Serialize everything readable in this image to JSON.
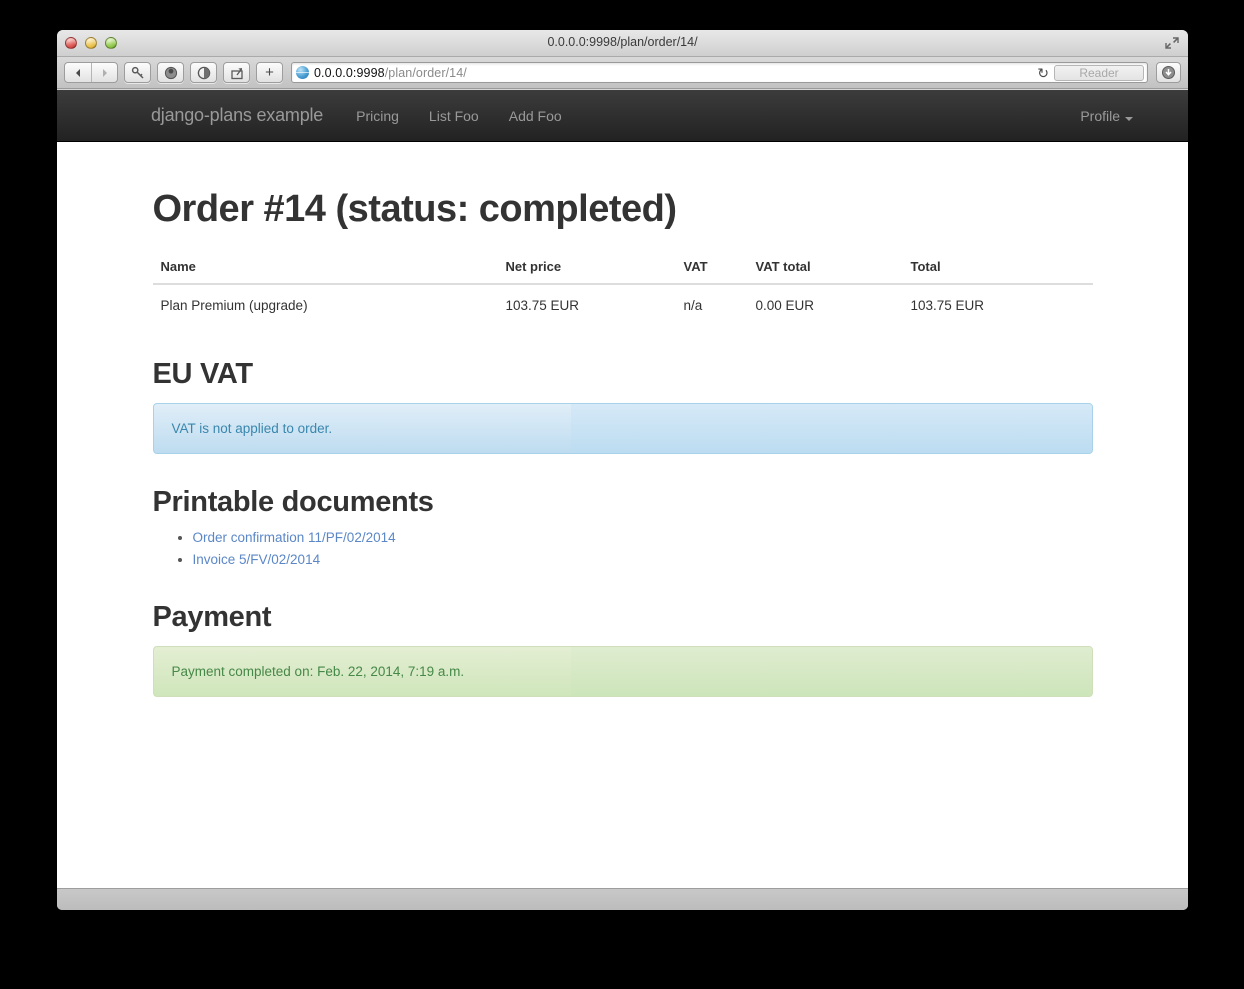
{
  "window": {
    "title": "0.0.0.0:9998/plan/order/14/",
    "fullscreen_icon": "fullscreen-arrows-icon",
    "traffic_lights": [
      "close",
      "minimize",
      "zoom"
    ]
  },
  "toolbar": {
    "back_icon": "back-arrow-icon",
    "forward_icon": "forward-arrow-icon",
    "key_icon": "key-icon",
    "topsites_icon": "top-sites-icon",
    "readinglist_icon": "reading-list-icon",
    "share_icon": "share-icon",
    "newtab_label": "+",
    "reload_icon": "reload-icon",
    "reader_label": "Reader",
    "downloads_icon": "downloads-icon"
  },
  "address": {
    "host": "0.0.0.0:9998",
    "path": "/plan/order/14/",
    "globe_icon": "globe-icon"
  },
  "navbar": {
    "brand": "django-plans example",
    "links": [
      {
        "label": "Pricing"
      },
      {
        "label": "List Foo"
      },
      {
        "label": "Add Foo"
      }
    ],
    "profile": {
      "label": "Profile",
      "caret_icon": "chevron-down-icon"
    }
  },
  "page": {
    "title": "Order #14 (status: completed)",
    "table": {
      "columns": [
        "Name",
        "Net price",
        "VAT",
        "VAT total",
        "Total"
      ],
      "rows": [
        {
          "name": "Plan Premium (upgrade)",
          "net_price": "103.75 EUR",
          "vat": "n/a",
          "vat_total": "0.00 EUR",
          "total": "103.75 EUR"
        }
      ]
    },
    "eu_vat": {
      "heading": "EU VAT",
      "alert_text": "VAT is not applied to order."
    },
    "printable_documents": {
      "heading": "Printable documents",
      "items": [
        {
          "label": "Order confirmation 11/PF/02/2014"
        },
        {
          "label": "Invoice 5/FV/02/2014"
        }
      ]
    },
    "payment": {
      "heading": "Payment",
      "alert_text": "Payment completed on: Feb. 22, 2014, 7:19 a.m."
    }
  },
  "colors": {
    "navbar_dark": "#222222",
    "link_blue": "#5b87c7",
    "info_text": "#3a87ad",
    "success_text": "#468847",
    "heading": "#333333"
  }
}
